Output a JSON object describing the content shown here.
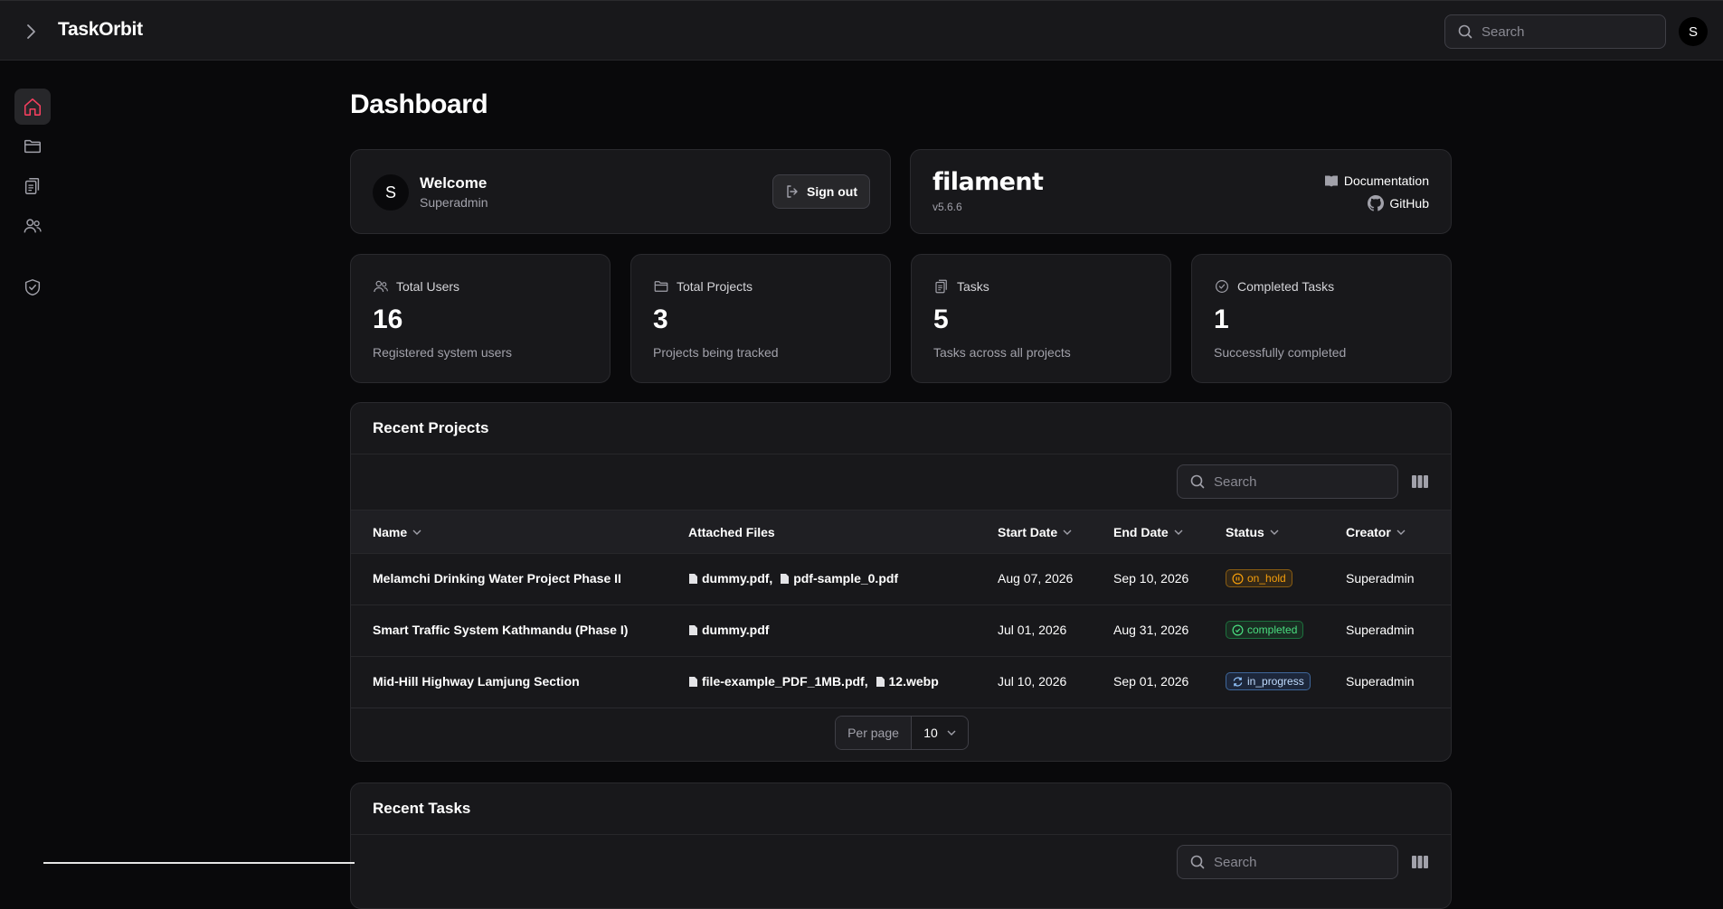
{
  "app": {
    "brand": "TaskOrbit"
  },
  "topbar": {
    "search_placeholder": "Search",
    "avatar_initial": "S"
  },
  "sidebar": {
    "items": [
      "home",
      "projects",
      "tasks",
      "users",
      "shield"
    ]
  },
  "page": {
    "title": "Dashboard"
  },
  "welcome": {
    "avatar_initial": "S",
    "title": "Welcome",
    "user": "Superadmin",
    "signout_label": "Sign out"
  },
  "filament": {
    "logo": "filament",
    "version": "v5.6.6",
    "docs_label": "Documentation",
    "github_label": "GitHub"
  },
  "stats": [
    {
      "label": "Total Users",
      "value": "16",
      "desc": "Registered system users"
    },
    {
      "label": "Total Projects",
      "value": "3",
      "desc": "Projects being tracked"
    },
    {
      "label": "Tasks",
      "value": "5",
      "desc": "Tasks across all projects"
    },
    {
      "label": "Completed Tasks",
      "value": "1",
      "desc": "Successfully completed"
    }
  ],
  "projects": {
    "title": "Recent Projects",
    "search_placeholder": "Search",
    "columns": [
      "Name",
      "Attached Files",
      "Start Date",
      "End Date",
      "Status",
      "Creator"
    ],
    "rows": [
      {
        "name": "Melamchi Drinking Water Project Phase II",
        "files": [
          "dummy.pdf,",
          "pdf-sample_0.pdf"
        ],
        "start": "Aug 07, 2026",
        "end": "Sep 10, 2026",
        "status": "on_hold",
        "creator": "Superadmin"
      },
      {
        "name": "Smart Traffic System Kathmandu (Phase I)",
        "files": [
          "dummy.pdf"
        ],
        "start": "Jul 01, 2026",
        "end": "Aug 31, 2026",
        "status": "completed",
        "creator": "Superadmin"
      },
      {
        "name": "Mid-Hill Highway Lamjung Section",
        "files": [
          "file-example_PDF_1MB.pdf,",
          "12.webp"
        ],
        "start": "Jul 10, 2026",
        "end": "Sep 01, 2026",
        "status": "in_progress",
        "creator": "Superadmin"
      }
    ],
    "per_page_label": "Per page",
    "per_page_value": "10"
  },
  "tasks_section": {
    "title": "Recent Tasks",
    "search_placeholder": "Search"
  },
  "colors": {
    "accent": "#f43f5e",
    "on_hold": "#f59e0b",
    "completed": "#22c55e",
    "in_progress": "#93c5fd"
  }
}
